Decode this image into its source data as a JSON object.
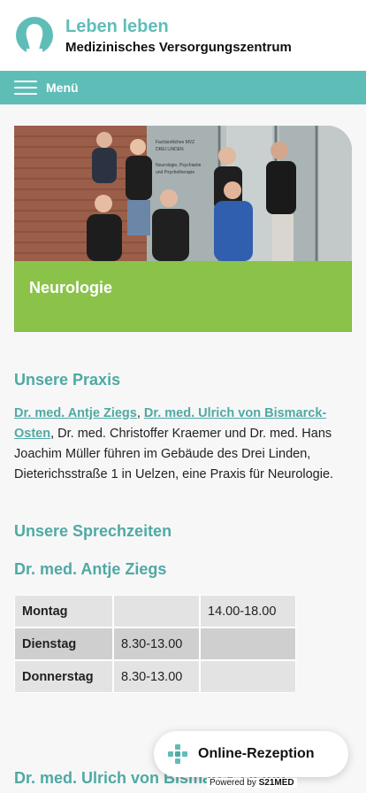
{
  "header": {
    "brand_title": "Leben leben",
    "brand_subtitle": "Medizinisches Versorgungszentrum",
    "logo_icon": "mvz-logo-icon",
    "accent_color": "#5fbdb8"
  },
  "navbar": {
    "menu_label": "Menü",
    "menu_icon": "hamburger-icon"
  },
  "hero": {
    "sign_text_1": "Fachärztliches MVZ",
    "sign_text_2": "DREI LINDEN",
    "sign_text_3": "Neurologie, Psychiatrie",
    "sign_text_4": "und Psychotherapie",
    "banner_title": "Neurologie",
    "banner_color": "#8bc34a"
  },
  "praxis": {
    "heading": "Unsere Praxis",
    "link_1": "Dr. med. Antje Ziegs",
    "sep_1": ", ",
    "link_2": "Dr. med. Ulrich von Bismarck-Osten",
    "text": ", Dr. med. Christoffer Kraemer und Dr. med. Hans Joachim Müller führen im Gebäude des Drei Linden, Dieterichsstraße 1 in Uelzen, eine Praxis für Neurologie."
  },
  "sprechzeiten": {
    "heading": "Unsere Sprechzeiten",
    "doctor_1": "Dr. med. Antje Ziegs",
    "doctor_2": "Dr. med. Ulrich von Bismarck-Osten",
    "rows": [
      {
        "day": "Montag",
        "morning": "",
        "afternoon": "14.00-18.00"
      },
      {
        "day": "Dienstag",
        "morning": "8.30-13.00",
        "afternoon": ""
      },
      {
        "day": "Donnerstag",
        "morning": "8.30-13.00",
        "afternoon": ""
      }
    ]
  },
  "fab": {
    "label": "Online-Rezeption",
    "icon": "plus-cross-icon",
    "powered_prefix": "Powered by ",
    "powered_brand": "S21MED"
  }
}
